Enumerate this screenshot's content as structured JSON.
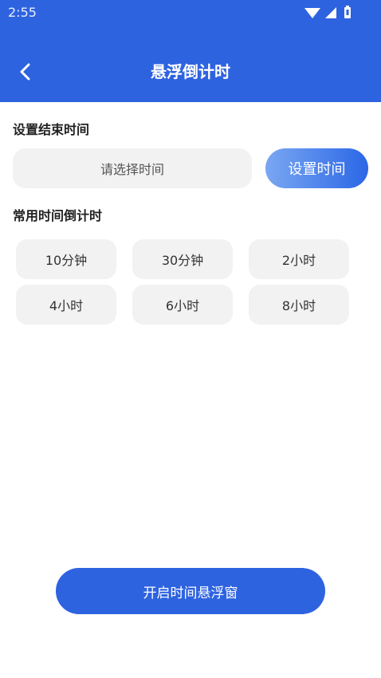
{
  "status_bar": {
    "time": "2:55",
    "icons": [
      "wifi-icon",
      "signal-icon",
      "battery-icon"
    ]
  },
  "header": {
    "title": "悬浮倒计时",
    "back_icon": "chevron-left-icon",
    "color": "#2e63e0"
  },
  "end_time": {
    "label": "设置结束时间",
    "select_placeholder": "请选择时间",
    "set_button": "设置时间"
  },
  "presets": {
    "label": "常用时间倒计时",
    "items": [
      "10分钟",
      "30分钟",
      "2小时",
      "4小时",
      "6小时",
      "8小时"
    ]
  },
  "footer": {
    "open_button": "开启时间悬浮窗"
  }
}
